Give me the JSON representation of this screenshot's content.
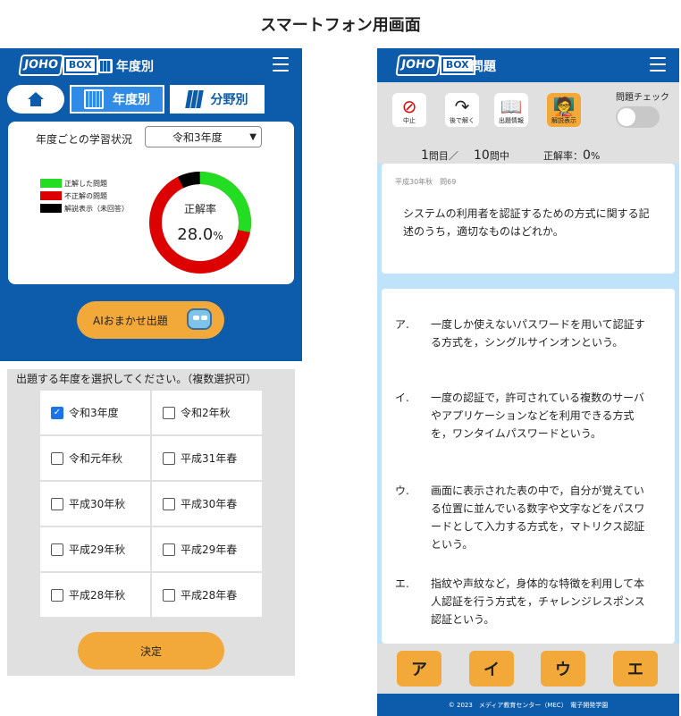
{
  "page_title": "スマートフォン用画面",
  "left": {
    "logo": {
      "jo": "JOHO",
      "box": "BOX"
    },
    "header_title": "年度別",
    "tabs": [
      {
        "label": "年度別",
        "icon": "calendar-icon",
        "active": true
      },
      {
        "label": "分野別",
        "icon": "books-icon",
        "active": false
      }
    ],
    "status_label": "年度ごとの学習状況",
    "year_select": "令和3年度",
    "legend": [
      "正解した問題",
      "不正解の問題",
      "解説表示（未回答）"
    ],
    "colors": {
      "correct": "#22dd22",
      "wrong": "#dd0000",
      "shown": "#000000",
      "accent": "#f3a83a",
      "brand": "#0d5bab"
    },
    "donut_label": "正解率",
    "donut_value": "28.0",
    "donut_unit": "%",
    "ai_button": "AIおまかせ出題",
    "select_prompt": "出題する年度を選択してください。（複数選択可）",
    "years": [
      {
        "label": "令和3年度",
        "checked": true
      },
      {
        "label": "令和2年秋",
        "checked": false
      },
      {
        "label": "令和元年秋",
        "checked": false
      },
      {
        "label": "平成31年春",
        "checked": false
      },
      {
        "label": "平成30年秋",
        "checked": false
      },
      {
        "label": "平成30年春",
        "checked": false
      },
      {
        "label": "平成29年秋",
        "checked": false
      },
      {
        "label": "平成29年春",
        "checked": false
      },
      {
        "label": "平成28年秋",
        "checked": false
      },
      {
        "label": "平成28年春",
        "checked": false
      }
    ],
    "decide_button": "決定"
  },
  "right": {
    "logo": {
      "jo": "JOHO",
      "box": "BOX"
    },
    "header_title": "問題",
    "tools": [
      {
        "label": "中止",
        "icon": "stop-icon"
      },
      {
        "label": "後で解く",
        "icon": "redo-arrow-icon"
      },
      {
        "label": "出題情報",
        "icon": "book-icon"
      },
      {
        "label": "解説表示",
        "icon": "teacher-icon"
      }
    ],
    "check_label": "問題チェック",
    "progress_num": "1",
    "progress_unit": "問目／",
    "total_num": "10",
    "total_unit": "問中",
    "rate_label": "正解率：",
    "rate_value": "0",
    "rate_unit": "%",
    "question_meta": "平成30年秋　問69",
    "question": "システムの利用者を認証するための方式に関する記述のうち，適切なものはどれか。",
    "answers": [
      {
        "key": "ア.",
        "text": "一度しか使えないパスワードを用いて認証する方式を，シングルサインオンという。"
      },
      {
        "key": "イ.",
        "text": "一度の認証で，許可されている複数のサーバやアプリケーションなどを利用できる方式を，ワンタイムパスワードという。"
      },
      {
        "key": "ウ.",
        "text": "画面に表示された表の中で，自分が覚えている位置に並んでいる数字や文字などをパスワードとして入力する方式を，マトリクス認証という。"
      },
      {
        "key": "エ.",
        "text": "指紋や声紋など，身体的な特徴を利用して本人認証を行う方式を，チャレンジレスポンス認証という。"
      }
    ],
    "answer_buttons": [
      "ア",
      "イ",
      "ウ",
      "エ"
    ],
    "footer": "© 2023　メディア教育センター（MEC）　電子開発学園"
  }
}
